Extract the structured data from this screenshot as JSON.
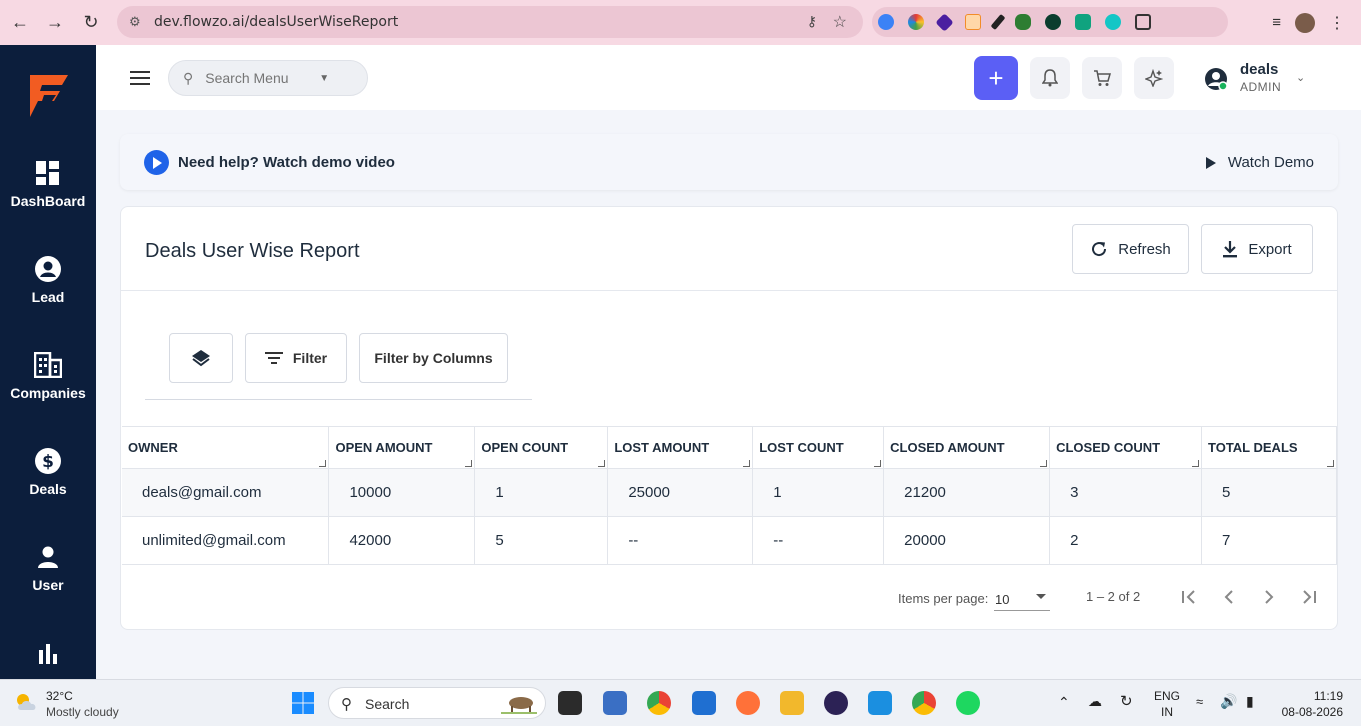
{
  "browser": {
    "url": "dev.flowzo.ai/dealsUserWiseReport"
  },
  "sidebar": {
    "items": [
      {
        "label": "DashBoard",
        "icon": "dashboard-icon"
      },
      {
        "label": "Lead",
        "icon": "lead-icon"
      },
      {
        "label": "Companies",
        "icon": "companies-icon"
      },
      {
        "label": "Deals",
        "icon": "deals-icon"
      },
      {
        "label": "User",
        "icon": "user-icon"
      },
      {
        "label": "",
        "icon": "reports-icon"
      }
    ]
  },
  "header": {
    "search_placeholder": "Search Menu",
    "user_name": "deals",
    "user_role": "ADMIN"
  },
  "help": {
    "text": "Need help? Watch demo video",
    "watch_demo": "Watch Demo"
  },
  "report": {
    "title": "Deals User Wise Report",
    "refresh_label": "Refresh",
    "export_label": "Export",
    "filter_label": "Filter",
    "filter_columns_label": "Filter by Columns",
    "columns": [
      "OWNER",
      "OPEN AMOUNT",
      "OPEN COUNT",
      "LOST AMOUNT",
      "LOST COUNT",
      "CLOSED AMOUNT",
      "CLOSED COUNT",
      "TOTAL DEALS"
    ],
    "rows": [
      [
        "deals@gmail.com",
        "10000",
        "1",
        "25000",
        "1",
        "21200",
        "3",
        "5"
      ],
      [
        "unlimited@gmail.com",
        "42000",
        "5",
        "--",
        "--",
        "20000",
        "2",
        "7"
      ]
    ],
    "paginator": {
      "items_per_page_label": "Items per page:",
      "items_per_page": "10",
      "range": "1 – 2 of 2"
    }
  },
  "taskbar": {
    "temperature": "32°C",
    "weather": "Mostly cloudy",
    "search_label": "Search",
    "lang_top": "ENG",
    "lang_bottom": "IN",
    "time": "11:19",
    "date": "08-08-2026"
  },
  "colors": {
    "sidebar_bg": "#0c1e3c",
    "accent": "#5b5ff5",
    "browser_bar": "#f7d9e3",
    "logo_orange": "#f25c22"
  }
}
